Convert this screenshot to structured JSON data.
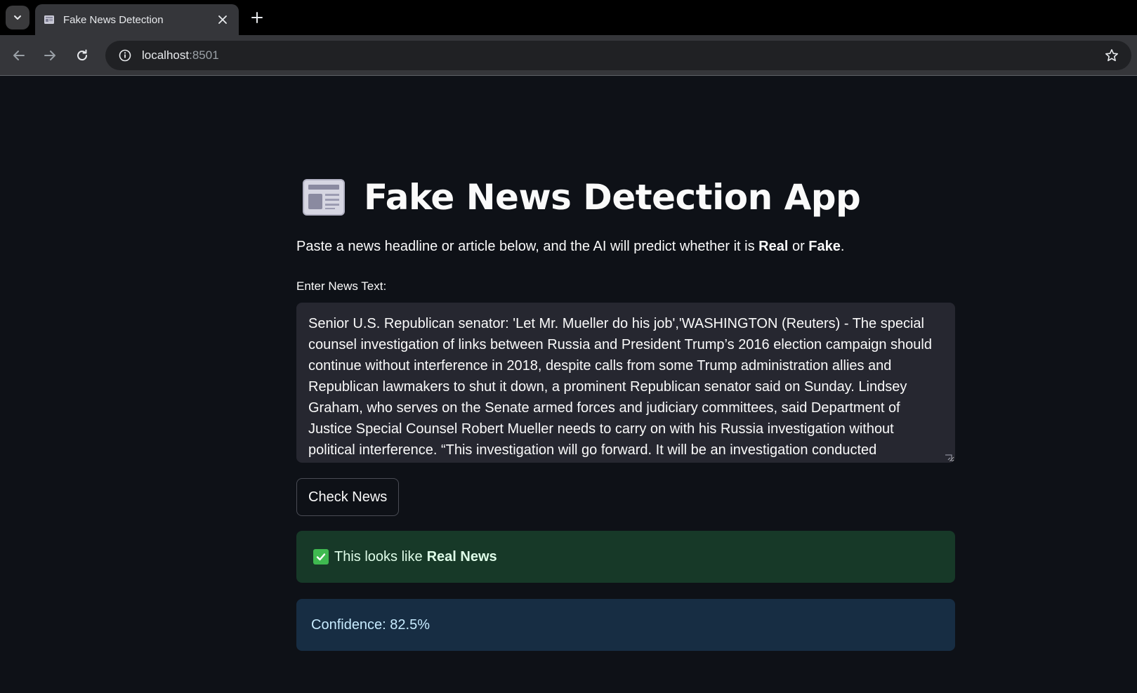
{
  "browser": {
    "tab_title": "Fake News Detection",
    "url_host": "localhost",
    "url_port": ":8501"
  },
  "app": {
    "title": "Fake News Detection App",
    "title_icon": "newspaper-icon",
    "subtitle_prefix": "Paste a news headline or article below, and the AI will predict whether it is ",
    "subtitle_real": "Real",
    "subtitle_or": " or ",
    "subtitle_fake": "Fake",
    "subtitle_end": ".",
    "input_label": "Enter News Text:",
    "input_value": "Senior U.S. Republican senator: 'Let Mr. Mueller do his job','WASHINGTON (Reuters) - The special counsel investigation of links between Russia and President Trump’s 2016 election campaign should continue without interference in 2018, despite calls from some Trump administration allies and Republican lawmakers to shut it down, a prominent Republican senator said on Sunday. Lindsey Graham, who serves on the Senate armed forces and judiciary committees, said Department of Justice Special Counsel Robert Mueller needs to carry on with his Russia investigation without political interference. “This investigation will go forward. It will be an investigation conducted",
    "button_label": "Check News",
    "result_prefix": "This looks like",
    "result_label": "Real News",
    "confidence_text": "Confidence: 82.5%"
  },
  "colors": {
    "background": "#0e1117",
    "success_bg": "#173928",
    "info_bg": "#172d43"
  }
}
